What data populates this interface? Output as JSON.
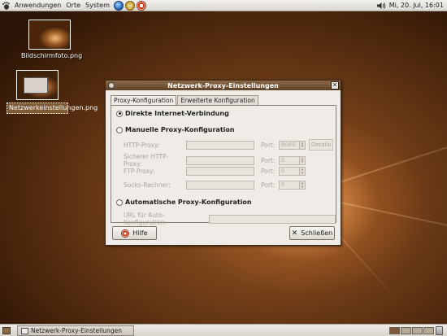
{
  "top_panel": {
    "menus": [
      "Anwendungen",
      "Orte",
      "System"
    ],
    "launchers": [
      "web-browser-icon",
      "mail-icon",
      "help-icon"
    ],
    "clock": "Mi, 20. Jul, 16:01"
  },
  "desktop": {
    "icons": [
      {
        "label": "Bildschirmfoto.png"
      },
      {
        "label": "Netzwerkeinstellungen.png"
      }
    ]
  },
  "dialog": {
    "title": "Netzwerk-Proxy-Einstellungen",
    "tabs": [
      "Proxy-Konfiguration",
      "Erweiterte Konfiguration"
    ],
    "active_tab": 0,
    "options": {
      "direct": "Direkte Internet-Verbindung",
      "manual": "Manuelle Proxy-Konfiguration",
      "auto": "Automatische Proxy-Konfiguration"
    },
    "selected_option": "direct",
    "proxy_rows": [
      {
        "label": "HTTP-Proxy:",
        "port_label": "Port:",
        "port": "8080"
      },
      {
        "label": "Sicherer HTTP-Proxy:",
        "port_label": "Port:",
        "port": "0"
      },
      {
        "label": "FTP-Proxy:",
        "port_label": "Port:",
        "port": "0"
      },
      {
        "label": "Socks-Rechner:",
        "port_label": "Port:",
        "port": "0"
      }
    ],
    "details_button": "Details",
    "auto_url_label": "URL für Auto-Konfiguration:",
    "help_button": "Hilfe",
    "close_button": "Schließen"
  },
  "bottom_panel": {
    "task": "Netzwerk-Proxy-Einstellungen",
    "workspaces": 4,
    "active_workspace": 0
  },
  "colors": {
    "accent_title": "#6f5032",
    "wallpaper": "#7a4418",
    "panel": "#ebe8e4"
  }
}
